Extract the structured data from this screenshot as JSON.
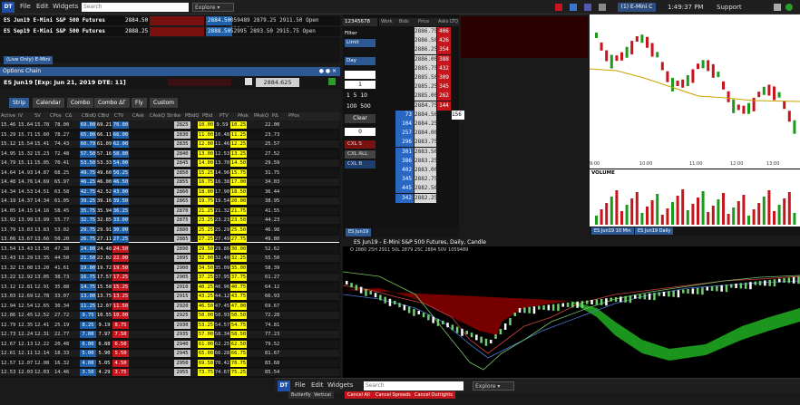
{
  "topbar": {
    "logo": "DT",
    "menu": [
      "File",
      "Edit",
      "Widgets"
    ],
    "search_placeholder": "Search",
    "explore_label": "Explore",
    "instrument_button": "(1) E-Mini C",
    "clock": "1:49:37 PM",
    "support": "Support"
  },
  "quotes": [
    {
      "name": "ES Jun19 E-Mini S&P 500 Futures",
      "last": "2884.50",
      "bid": "2884.50",
      "rest": "059489 2879.25 2911.50 Open 21Jun19"
    },
    {
      "name": "ES Sep19 E-Mini S&P 500 Futures",
      "last": "2888.25",
      "bid": "2888.50",
      "rest": "52995 2893.50 2915.75 Open 20Sep19"
    }
  ],
  "left_mid": {
    "filter_tag": "(Live Only) E-Mini"
  },
  "options": {
    "title": "Options Chain",
    "subtitle": "ES Jun19 [Exp: Jun 21, 2019 DTE: 11]",
    "price_box": "2884.625",
    "tabs": [
      "Strip",
      "Calendar",
      "Combo",
      "Combo ΔΓ",
      "Fly",
      "Custom"
    ],
    "headers": [
      "Active",
      "IV",
      "SV",
      "CPos",
      "CΔ",
      "CBidQ",
      "CBid",
      "CTV",
      "CAsk",
      "CAskQ",
      "Strike",
      "PBidQ",
      "PBid",
      "PTV",
      "PAsk",
      "PAskQ",
      "PΔ",
      "PPos"
    ],
    "rows": [
      [
        "15.46",
        "15.64",
        "15.78",
        "78.00",
        "69.00",
        "69.21",
        "70.00",
        "2825",
        "10.00",
        "9.59",
        "10.25",
        "22.00"
      ],
      [
        "15.29",
        "15.71",
        "15.60",
        "78.27",
        "65.00",
        "66.11",
        "66.00",
        "2830",
        "11.00",
        "10.48",
        "11.25",
        "23.73"
      ],
      [
        "15.12",
        "15.54",
        "15.41",
        "74.43",
        "60.79",
        "61.09",
        "62.00",
        "2835",
        "12.00",
        "11.46",
        "12.25",
        "25.57"
      ],
      [
        "14.95",
        "15.32",
        "15.23",
        "72.48",
        "57.50",
        "57.16",
        "58.00",
        "2840",
        "13.00",
        "12.53",
        "13.25",
        "27.52"
      ],
      [
        "14.79",
        "15.11",
        "15.05",
        "70.41",
        "53.50",
        "53.33",
        "54.00",
        "2845",
        "14.00",
        "13.70",
        "14.50",
        "29.59"
      ],
      [
        "14.64",
        "14.93",
        "14.87",
        "68.25",
        "49.75",
        "49.60",
        "50.25",
        "2850",
        "15.25",
        "14.96",
        "15.75",
        "31.75"
      ],
      [
        "14.48",
        "14.76",
        "14.69",
        "65.97",
        "46.25",
        "46.00",
        "46.50",
        "2855",
        "16.75",
        "16.38",
        "17.00",
        "34.03"
      ],
      [
        "14.34",
        "14.53",
        "14.51",
        "63.58",
        "42.75",
        "42.52",
        "43.00",
        "2860",
        "18.00",
        "17.90",
        "18.50",
        "36.44"
      ],
      [
        "14.19",
        "14.37",
        "14.34",
        "61.05",
        "39.25",
        "39.16",
        "39.50",
        "2865",
        "19.75",
        "19.54",
        "20.00",
        "38.95"
      ],
      [
        "14.05",
        "14.15",
        "14.16",
        "58.45",
        "35.75",
        "35.94",
        "36.25",
        "2870",
        "21.25",
        "21.32",
        "21.75",
        "41.55"
      ],
      [
        "13.92",
        "13.99",
        "13.99",
        "55.77",
        "32.75",
        "32.85",
        "33.00",
        "2875",
        "23.25",
        "23.23",
        "23.50",
        "44.23"
      ],
      [
        "13.79",
        "13.83",
        "13.83",
        "53.02",
        "29.75",
        "29.91",
        "30.00",
        "2880",
        "25.25",
        "25.29",
        "25.50",
        "46.98"
      ],
      [
        "13.66",
        "13.67",
        "13.66",
        "50.20",
        "26.75",
        "27.11",
        "27.25",
        "2885",
        "27.25",
        "27.49",
        "27.75",
        "49.80"
      ],
      [
        "13.54",
        "13.43",
        "13.50",
        "47.38",
        "24.00",
        "24.48",
        "24.50",
        "2890",
        "29.50",
        "29.86",
        "30.00",
        "52.62"
      ],
      [
        "13.43",
        "13.29",
        "13.35",
        "44.50",
        "21.50",
        "22.02",
        "22.00",
        "2895",
        "32.00",
        "32.40",
        "32.25",
        "55.50"
      ],
      [
        "13.32",
        "13.08",
        "13.20",
        "41.61",
        "19.00",
        "19.72",
        "19.50",
        "2900",
        "34.50",
        "35.09",
        "35.00",
        "58.39"
      ],
      [
        "13.22",
        "12.92",
        "13.05",
        "38.73",
        "16.75",
        "17.57",
        "17.25",
        "2905",
        "37.25",
        "37.95",
        "37.75",
        "61.27"
      ],
      [
        "13.12",
        "12.81",
        "12.91",
        "35.88",
        "14.75",
        "15.58",
        "15.25",
        "2910",
        "40.25",
        "40.96",
        "40.75",
        "64.12"
      ],
      [
        "13.03",
        "12.69",
        "12.78",
        "33.07",
        "13.00",
        "13.75",
        "13.25",
        "2915",
        "43.25",
        "44.12",
        "43.75",
        "66.93"
      ],
      [
        "12.94",
        "12.54",
        "12.65",
        "30.34",
        "11.25",
        "12.07",
        "11.50",
        "2920",
        "46.50",
        "47.45",
        "47.00",
        "69.67"
      ],
      [
        "12.86",
        "12.45",
        "12.52",
        "27.72",
        "9.75",
        "10.55",
        "10.00",
        "2925",
        "50.00",
        "50.93",
        "50.50",
        "72.28"
      ],
      [
        "12.79",
        "12.35",
        "12.41",
        "25.19",
        "8.25",
        "9.19",
        "8.75",
        "2930",
        "53.25",
        "54.57",
        "54.75",
        "74.81"
      ],
      [
        "12.73",
        "12.24",
        "12.31",
        "22.77",
        "7.00",
        "7.97",
        "7.50",
        "2935",
        "57.00",
        "58.34",
        "58.50",
        "77.23"
      ],
      [
        "12.67",
        "12.13",
        "12.22",
        "20.48",
        "6.00",
        "6.88",
        "6.50",
        "2940",
        "61.00",
        "62.25",
        "62.50",
        "79.52"
      ],
      [
        "12.61",
        "12.11",
        "12.14",
        "18.33",
        "5.00",
        "5.90",
        "5.50",
        "2945",
        "65.00",
        "66.28",
        "66.75",
        "81.67"
      ],
      [
        "12.57",
        "12.07",
        "12.08",
        "16.32",
        "4.00",
        "5.05",
        "4.50",
        "2950",
        "69.50",
        "70.42",
        "70.75",
        "83.68"
      ],
      [
        "12.53",
        "12.03",
        "12.03",
        "14.46",
        "3.50",
        "4.29",
        "3.75",
        "2955",
        "73.75",
        "74.67",
        "75.25",
        "85.54"
      ]
    ]
  },
  "ladder": {
    "header": [
      "Work",
      "Bids",
      "Price",
      "Asks",
      "LTQ"
    ],
    "account": "12345678",
    "filter": "Filter",
    "order_type": "Limit",
    "tif": "Day",
    "qty": "1",
    "qty_presets": [
      "1",
      "5",
      "10",
      "100",
      "500"
    ],
    "clear": "Clear",
    "zero": "0",
    "rows": [
      [
        "",
        "2886.75",
        "406"
      ],
      [
        "",
        "2886.50",
        "426"
      ],
      [
        "",
        "2886.25",
        "354"
      ],
      [
        "",
        "2886.00",
        "388"
      ],
      [
        "",
        "2885.75",
        "432"
      ],
      [
        "",
        "2885.50",
        "309"
      ],
      [
        "",
        "2885.25",
        "345"
      ],
      [
        "",
        "2885.00",
        "262"
      ],
      [
        "",
        "2884.75",
        "144"
      ],
      [
        "73",
        "2884.50",
        ""
      ],
      [
        "104",
        "2884.25",
        ""
      ],
      [
        "257",
        "2884.00",
        ""
      ],
      [
        "296",
        "2883.75",
        ""
      ],
      [
        "301",
        "2883.50",
        ""
      ],
      [
        "386",
        "2883.25",
        ""
      ],
      [
        "402",
        "2883.00",
        ""
      ],
      [
        "345",
        "2882.75",
        ""
      ],
      [
        "445",
        "2882.50",
        ""
      ],
      [
        "342",
        "2882.25",
        ""
      ]
    ],
    "ltq_value": "156",
    "cxl_buttons": [
      "CXL S",
      "CXL ALL",
      "CXL B"
    ],
    "tag": "ES Jun19"
  },
  "minichart": {
    "time_labels": [
      "9:00",
      "10:00",
      "11:00",
      "12:00",
      "13:00"
    ],
    "volume_label": "VOLUME",
    "tags": [
      "ES Jun19 10 Min",
      "ES Jun19 Daily"
    ]
  },
  "dailychart": {
    "title": "ES Jun19 - E-Mini S&P 500 Futures, Daily, Candle",
    "stats": "O 2880 25H 2911 50L 2879 25C 2884 50V 1059489"
  },
  "footer": {
    "menu": [
      "File",
      "Edit",
      "Widgets"
    ],
    "search_placeholder": "Search",
    "explore": "Explore",
    "buttons": [
      "Butterfly",
      "Vertical",
      "Cancel All",
      "Cancel Spreads",
      "Cancel Outrights"
    ]
  },
  "colors": {
    "accent": "#1d5fa8",
    "buy": "#2a67c2",
    "sell": "#c4161c",
    "yellow": "#ffff00"
  }
}
